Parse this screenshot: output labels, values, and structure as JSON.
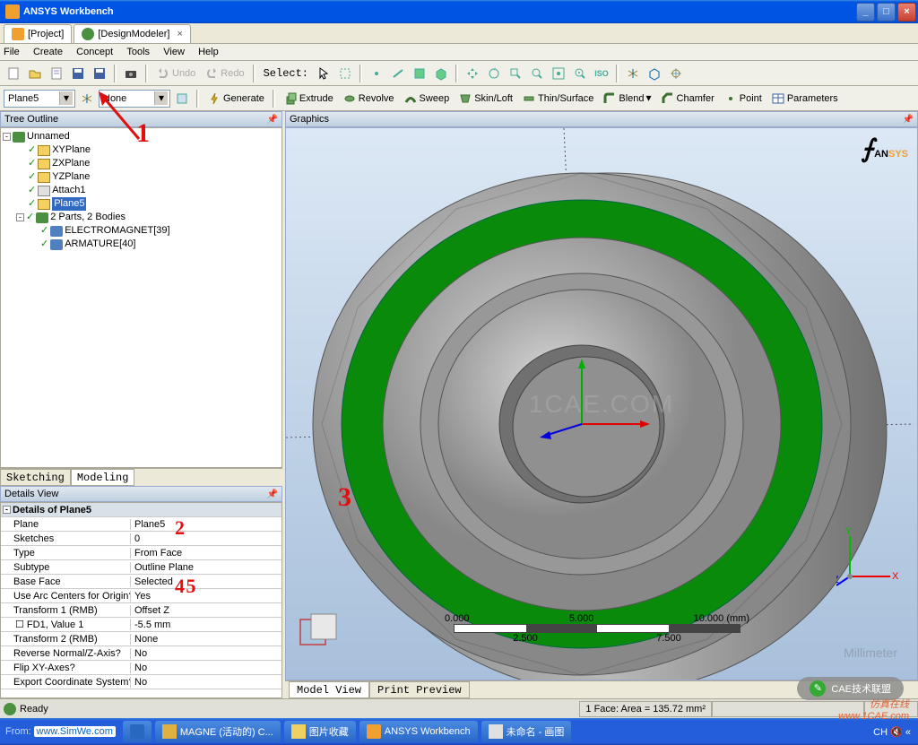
{
  "window": {
    "title": "ANSYS Workbench"
  },
  "tabs": [
    {
      "label": "[Project]"
    },
    {
      "label": "[DesignModeler]"
    }
  ],
  "menu": [
    "File",
    "Create",
    "Concept",
    "Tools",
    "View",
    "Help"
  ],
  "toolbar1": {
    "undo": "Undo",
    "redo": "Redo",
    "select": "Select:"
  },
  "toolbar2": {
    "plane_combo": "Plane5",
    "sketch_combo": "None",
    "generate": "Generate",
    "extrude": "Extrude",
    "revolve": "Revolve",
    "sweep": "Sweep",
    "skinloft": "Skin/Loft",
    "thinsurf": "Thin/Surface",
    "blend": "Blend",
    "chamfer": "Chamfer",
    "point": "Point",
    "parameters": "Parameters"
  },
  "tree": {
    "title": "Tree Outline",
    "root": "Unnamed",
    "items": [
      "XYPlane",
      "ZXPlane",
      "YZPlane",
      "Attach1",
      "Plane5",
      "2 Parts, 2 Bodies"
    ],
    "bodies": [
      "ELECTROMAGNET[39]",
      "ARMATURE[40]"
    ]
  },
  "sketch_tabs": {
    "sketching": "Sketching",
    "modeling": "Modeling"
  },
  "details": {
    "title": "Details View",
    "header": "Details of Plane5",
    "rows": [
      {
        "k": "Plane",
        "v": "Plane5"
      },
      {
        "k": "Sketches",
        "v": "0"
      },
      {
        "k": "Type",
        "v": "From Face"
      },
      {
        "k": "Subtype",
        "v": "Outline Plane"
      },
      {
        "k": "Base Face",
        "v": "Selected"
      },
      {
        "k": "Use Arc Centers for Origin?",
        "v": "Yes"
      },
      {
        "k": "Transform 1 (RMB)",
        "v": "Offset Z"
      },
      {
        "k": "FD1, Value 1",
        "v": "-5.5 mm"
      },
      {
        "k": "Transform 2 (RMB)",
        "v": "None"
      },
      {
        "k": "Reverse Normal/Z-Axis?",
        "v": "No"
      },
      {
        "k": "Flip XY-Axes?",
        "v": "No"
      },
      {
        "k": "Export Coordinate System?",
        "v": "No"
      }
    ]
  },
  "graphics": {
    "title": "Graphics",
    "logo1": "AN",
    "logo2": "SYS",
    "scale": {
      "l0": "0.000",
      "l1": "2.500",
      "l2": "5.000",
      "l3": "7.500",
      "l4": "10.000 (mm)"
    },
    "tabs": {
      "mv": "Model View",
      "pp": "Print Preview"
    },
    "center_wm": "1CAE.COM",
    "mill_wm": "Millimeter"
  },
  "status": {
    "ready": "Ready",
    "from": "From:",
    "url": "www.SimWe.com",
    "face": "1 Face: Area = 135.72 mm²"
  },
  "taskbar": {
    "items": [
      "MAGNE (活动的) C...",
      "图片收藏",
      "ANSYS Workbench",
      "未命名 - 画图"
    ]
  },
  "annotations": {
    "a1": "1",
    "a3": "3",
    "a2": "2",
    "a45": "4 5"
  },
  "watermark": {
    "line1": "仿真在线",
    "line2": "www.1CAE.com",
    "badge": "CAE技术联盟"
  }
}
